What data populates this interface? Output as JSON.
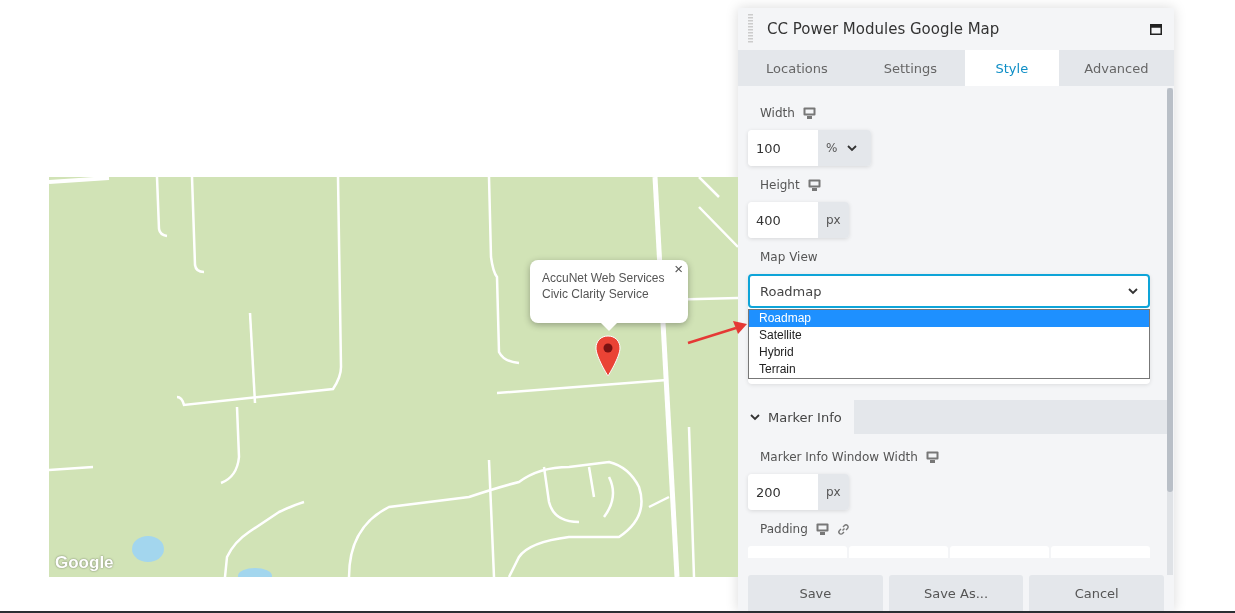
{
  "map": {
    "info_window": {
      "lines": [
        "AccuNet Web Services",
        "Civic Clarity Service"
      ],
      "close": "×"
    },
    "logo": "Google"
  },
  "panel": {
    "title": "CC Power Modules Google Map",
    "tabs": [
      {
        "label": "Locations",
        "selected": false
      },
      {
        "label": "Settings",
        "selected": false
      },
      {
        "label": "Style",
        "selected": true
      },
      {
        "label": "Advanced",
        "selected": false
      }
    ],
    "fields": [
      {
        "kind": "unit",
        "label": "Width",
        "value": "100",
        "unit": "%",
        "unit_dropdown": true
      },
      {
        "kind": "unit",
        "label": "Height",
        "value": "400",
        "unit": "px",
        "unit_dropdown": false
      },
      {
        "kind": "select",
        "label": "Map View",
        "value": "Roadmap",
        "expanded": true,
        "options": [
          {
            "label": "Roadmap",
            "selected": true
          },
          {
            "label": "Satellite",
            "selected": false
          },
          {
            "label": "Hybrid",
            "selected": false
          },
          {
            "label": "Terrain",
            "selected": false
          }
        ]
      }
    ],
    "section": {
      "title": "Marker Info",
      "expanded": true,
      "fields": [
        {
          "kind": "unit",
          "label": "Marker Info Window Width",
          "value": "200",
          "unit": "px",
          "unit_dropdown": false
        },
        {
          "kind": "dimension",
          "label": "Padding",
          "linked": true
        }
      ]
    },
    "buttons": [
      "Save",
      "Save As...",
      "Cancel"
    ]
  }
}
